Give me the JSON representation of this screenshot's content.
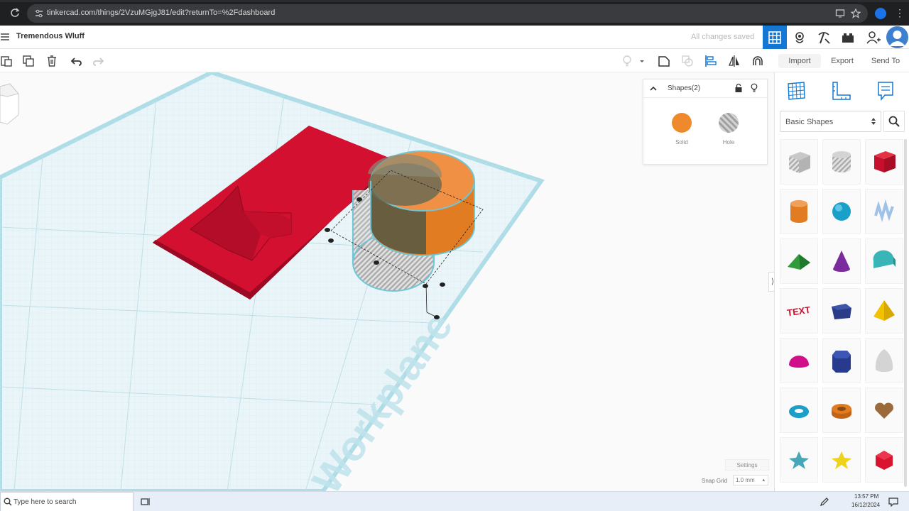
{
  "browser": {
    "url": "tinkercad.com/things/2VzuMGjgJ81/edit?returnTo=%2Fdashboard"
  },
  "header": {
    "design_title": "Tremendous Wluff",
    "save_status": "All changes saved"
  },
  "right_tabs": {
    "import": "Import",
    "export": "Export",
    "send_to": "Send To"
  },
  "inspector": {
    "title": "Shapes(2)",
    "solid_label": "Solid",
    "hole_label": "Hole"
  },
  "workplane": {
    "label": "Workplane"
  },
  "settings": {
    "settings_label": "Settings",
    "snap_grid_label": "Snap Grid",
    "snap_grid_value": "1.0 mm"
  },
  "library": {
    "category": "Basic Shapes",
    "shapes": [
      "box-hole",
      "cylinder-hole",
      "box",
      "cylinder",
      "sphere",
      "scribble",
      "roof",
      "cone",
      "round-roof",
      "text",
      "half-box",
      "pyramid",
      "half-sphere",
      "polygon",
      "paraboloid",
      "torus",
      "tube",
      "heart",
      "star-teal",
      "star-yellow",
      "icosahedron"
    ]
  },
  "taskbar": {
    "search_placeholder": "Type here to search",
    "time": "13:57 PM",
    "date": "16/12/2024"
  },
  "colors": {
    "accent": "#1477d4",
    "solid": "#ee8a2c",
    "red_box": "#d40f2e",
    "workplane": "#e6f4f7"
  }
}
